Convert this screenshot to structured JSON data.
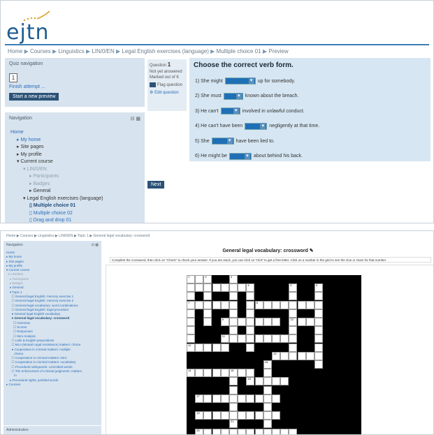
{
  "shot1": {
    "logo": "ejtn",
    "breadcrumb": [
      "Home",
      "Courses",
      "Linguistics",
      "LIN/0/EN",
      "Legal English exercises (language)",
      "Multiple choice 01",
      "Preview"
    ],
    "quiz_nav": {
      "title": "Quiz navigation",
      "question_number": "1",
      "finish_link": "Finish attempt ...",
      "new_preview_button": "Start a new preview"
    },
    "navigation": {
      "title": "Navigation",
      "items": [
        {
          "label": "Home",
          "style": "lnk",
          "indent": 0
        },
        {
          "label": "My home",
          "style": "lnk",
          "indent": 1
        },
        {
          "label": "Site pages",
          "style": "plain",
          "indent": 1
        },
        {
          "label": "My profile",
          "style": "plain",
          "indent": 1
        },
        {
          "label": "Current course",
          "style": "plain",
          "indent": 1
        },
        {
          "label": "LIN/0/EN",
          "style": "gry",
          "indent": 2
        },
        {
          "label": "Participants",
          "style": "gry",
          "indent": 3
        },
        {
          "label": "Badges",
          "style": "gry",
          "indent": 3
        },
        {
          "label": "General",
          "style": "plain",
          "indent": 3
        },
        {
          "label": "Legal English exercises (language)",
          "style": "plain",
          "indent": 2
        },
        {
          "label": "Multiple choice 01",
          "style": "sel",
          "indent": 3
        },
        {
          "label": "Multiple choice 02",
          "style": "lnk",
          "indent": 3
        },
        {
          "label": "Drag and drop 01",
          "style": "lnk",
          "indent": 3
        }
      ]
    },
    "question_info": {
      "label": "Question",
      "number": "1",
      "status": "Not yet answered",
      "marked": "Marked out of 6",
      "flag": "Flag question",
      "edit": "Edit question"
    },
    "next_button": "Next",
    "question": {
      "title": "Choose the correct verb form.",
      "rows": [
        {
          "before": "1) She might",
          "after": "up for somebody."
        },
        {
          "before": "2) She must",
          "after": "known about the breach."
        },
        {
          "before": "3) He can't",
          "after": "involved in unlawful conduct."
        },
        {
          "before": "4) He can't have been",
          "after": "negligently at that time."
        },
        {
          "before": "5) She",
          "after": "have been lied to."
        },
        {
          "before": "6) He might be",
          "after": "about behind his back."
        }
      ]
    }
  },
  "shot2": {
    "breadcrumb": "Home ▶ Courses ▶ Linguistics ▶ LIN/0/EN ▶ Topic 1 ▶ General legal vocabulary: crossword",
    "nav_title": "Navigation",
    "nav_items": [
      {
        "label": "Home",
        "style": "lnk"
      },
      {
        "label": "▸ My home",
        "style": "lnk"
      },
      {
        "label": "▸ Site pages",
        "style": "lnk"
      },
      {
        "label": "▸ My profile",
        "style": "lnk"
      },
      {
        "label": "▾ Current course",
        "style": "lnk"
      },
      {
        "label": "  ▾ LIN/0/EN",
        "style": "gry"
      },
      {
        "label": "    ▸ Participants",
        "style": "gry"
      },
      {
        "label": "    ▸ Badges",
        "style": "gry"
      },
      {
        "label": "    ▸ General",
        "style": "lnk"
      },
      {
        "label": "    ▾ Topic 1",
        "style": "lnk"
      },
      {
        "label": "      ☐ General legal English: memory exercise 1",
        "style": "lnk"
      },
      {
        "label": "      ☐ General legal English: memory exercise 2",
        "style": "lnk"
      },
      {
        "label": "      ☐ General legal vocabulary: word combinations",
        "style": "lnk"
      },
      {
        "label": "      ☐ General legal English: legal procedure",
        "style": "lnk"
      },
      {
        "label": "      ● General legal English vocabulary",
        "style": "lnk"
      },
      {
        "label": "      ● General legal vocabulary: crossword",
        "style": "sel"
      },
      {
        "label": "        ☐ Overview",
        "style": "lnk"
      },
      {
        "label": "        ☐ Scores",
        "style": "lnk"
      },
      {
        "label": "        ☐ Responses",
        "style": "lnk"
      },
      {
        "label": "        ☐ Item Analysis",
        "style": "lnk"
      },
      {
        "label": "      ☐ Latin & English prepositions",
        "style": "lnk"
      },
      {
        "label": "      ☐ MLA (Mutual Legal Assistance) matters: choice",
        "style": "lnk"
      },
      {
        "label": "      ● Cooperation in criminal matters: multiple",
        "style": "lnk"
      },
      {
        "label": "         choice",
        "style": "lnk"
      },
      {
        "label": "      ☐ Cooperation in criminal matters: intro",
        "style": "lnk"
      },
      {
        "label": "      ☐ Cooperation in criminal matters: vocabulary",
        "style": "lnk"
      },
      {
        "label": "      ☐ Procedural safeguards: committed words",
        "style": "lnk"
      },
      {
        "label": "      ☐ The enforcement of criminal judgments: matters",
        "style": "lnk"
      },
      {
        "label": "         in",
        "style": "lnk"
      },
      {
        "label": "    ▸ Procedural rights: jumbled words",
        "style": "lnk"
      },
      {
        "label": "▸ Courses",
        "style": "lnk"
      }
    ],
    "admin_title": "Administration",
    "crossword_title": "General legal vocabulary: crossword ✎",
    "instructions": "Complete the crossword, then click on \"Check\" to check your answer. If you are stuck, you can click on \"Hint\" to get a free letter. Click on a number in the grid to see the clue or clues for that number.",
    "clue_numbers": [
      "1",
      "2",
      "3",
      "4",
      "5",
      "6",
      "7",
      "8",
      "9",
      "10",
      "11",
      "12",
      "13",
      "14",
      "15",
      "16",
      "17",
      "18",
      "19",
      "20",
      "21"
    ]
  }
}
